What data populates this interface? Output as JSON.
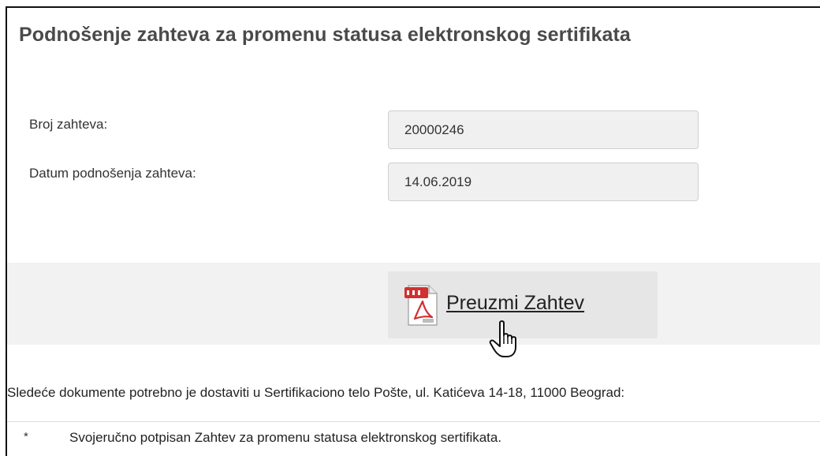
{
  "form": {
    "title": "Podnošenje zahteva za promenu statusa elektronskog sertifikata",
    "fields": [
      {
        "label": "Broj zahteva:",
        "value": "20000246"
      },
      {
        "label": "Datum podnošenja zahteva:",
        "value": "14.06.2019"
      }
    ]
  },
  "download": {
    "label": "Preuzmi Zahtev",
    "icon": "pdf-file-icon"
  },
  "documents": {
    "note": "Sledeće dokumente potrebno je dostaviti u Sertifikaciono telo Pošte, ul. Katićeva 14-18, 11000 Beograd:",
    "items": [
      {
        "bullet": "*",
        "text": "Svojeručno potpisan Zahtev za promenu statusa elektronskog sertifikata."
      }
    ]
  },
  "colors": {
    "field_background": "#f0f0f0",
    "download_band": "#f2f2f2",
    "download_button": "#e6e6e6",
    "pdf_red": "#d32f2f"
  }
}
